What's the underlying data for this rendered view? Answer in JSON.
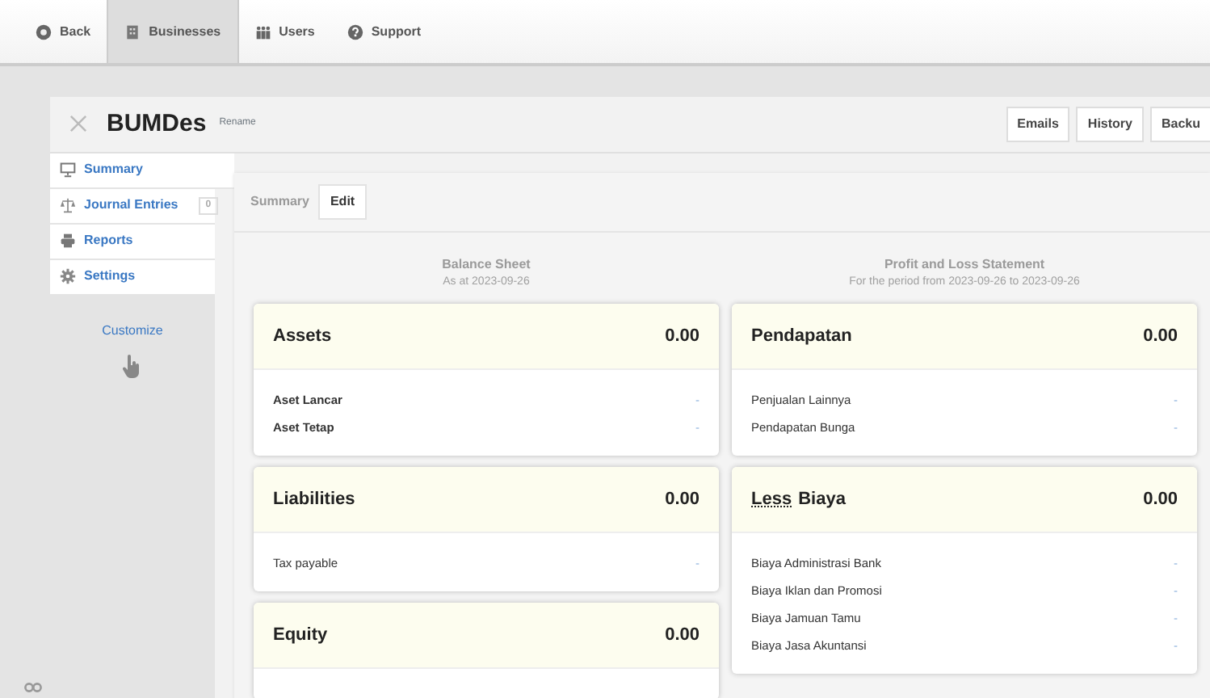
{
  "top_nav": [
    {
      "label": "Back",
      "selected": false
    },
    {
      "label": "Businesses",
      "selected": true
    },
    {
      "label": "Users",
      "selected": false
    },
    {
      "label": "Support",
      "selected": false
    }
  ],
  "business": {
    "name": "BUMDes",
    "rename": "Rename",
    "buttons": [
      "Emails",
      "History",
      "Backu"
    ]
  },
  "sidebar": {
    "items": [
      {
        "label": "Summary",
        "selected": true
      },
      {
        "label": "Journal Entries",
        "badge": "0",
        "selected": false
      },
      {
        "label": "Reports",
        "selected": false
      },
      {
        "label": "Settings",
        "selected": false
      }
    ],
    "customize": "Customize"
  },
  "toolbar": {
    "title": "Summary",
    "edit": "Edit"
  },
  "columns": [
    {
      "title": "Balance Sheet",
      "subtitle": "As at 2023-09-26",
      "sections": [
        {
          "heading": "Assets",
          "total": "0.00",
          "rows": [
            {
              "label": "Aset Lancar",
              "value": "-",
              "bold": true
            },
            {
              "label": "Aset Tetap",
              "value": "-",
              "bold": true
            }
          ]
        },
        {
          "heading": "Liabilities",
          "total": "0.00",
          "rows": [
            {
              "label": "Tax payable",
              "value": "-",
              "bold": false
            }
          ]
        },
        {
          "heading": "Equity",
          "total": "0.00"
        }
      ]
    },
    {
      "title": "Profit and Loss Statement",
      "subtitle": "For the period from 2023-09-26 to 2023-09-26",
      "sections": [
        {
          "heading": "Pendapatan",
          "total": "0.00",
          "rows": [
            {
              "label": "Penjualan Lainnya",
              "value": "-",
              "bold": false
            },
            {
              "label": "Pendapatan Bunga",
              "value": "-",
              "bold": false
            }
          ]
        },
        {
          "prefix": "Less",
          "heading": "Biaya",
          "total": "0.00",
          "rows": [
            {
              "label": "Biaya Administrasi Bank",
              "value": "-",
              "bold": false
            },
            {
              "label": "Biaya Iklan dan Promosi",
              "value": "-",
              "bold": false
            },
            {
              "label": "Biaya Jamuan Tamu",
              "value": "-",
              "bold": false
            },
            {
              "label": "Biaya Jasa Akuntansi",
              "value": "-",
              "bold": false
            }
          ]
        }
      ]
    }
  ]
}
